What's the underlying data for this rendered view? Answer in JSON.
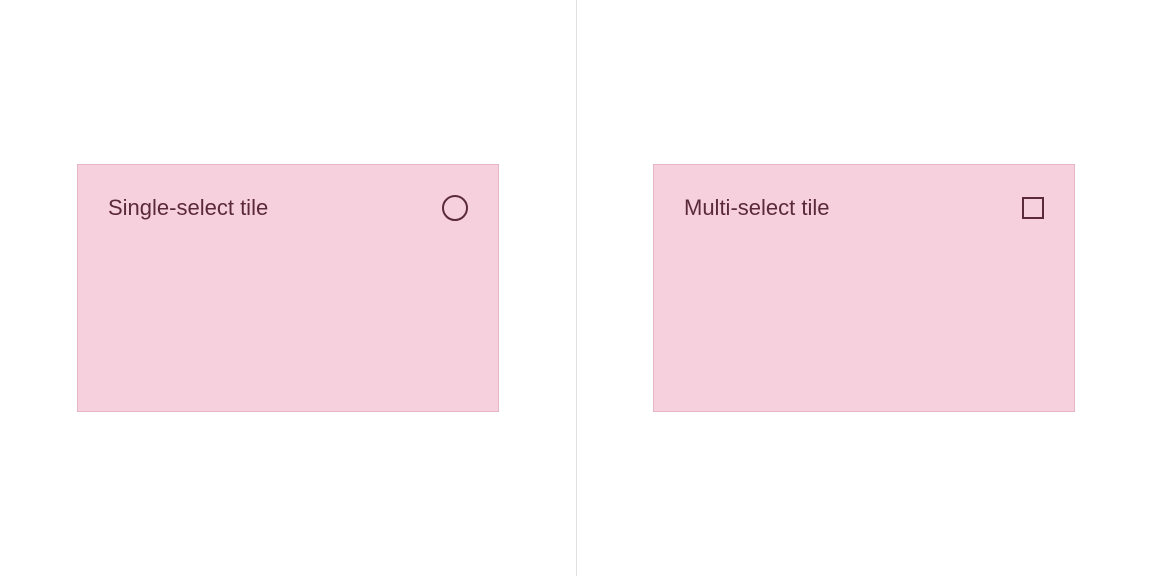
{
  "left": {
    "tile_label": "Single-select tile",
    "control_type": "radio"
  },
  "right": {
    "tile_label": "Multi-select tile",
    "control_type": "checkbox"
  },
  "colors": {
    "tile_bg": "#f7d0dd",
    "tile_border": "#e6b5c7",
    "text": "#5a2a3b",
    "divider": "#e0e0e0"
  }
}
